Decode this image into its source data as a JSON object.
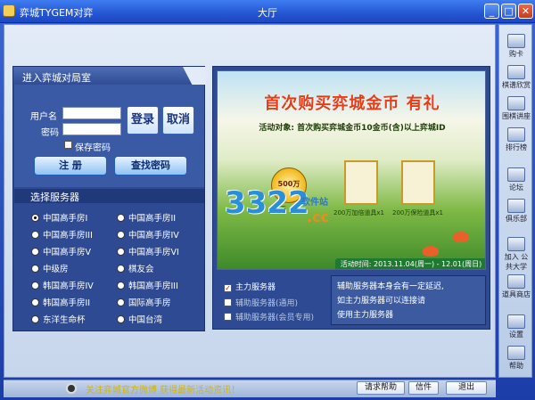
{
  "window": {
    "app_title": "弈城TYGEM对弈",
    "center_title": "大厅",
    "controls": [
      "minimize",
      "maximize",
      "close"
    ]
  },
  "sidebar": {
    "items": [
      {
        "label": "购卡",
        "icon": "card-icon"
      },
      {
        "label": "棋谱欣赏",
        "icon": "board-icon"
      },
      {
        "label": "围棋讲座",
        "icon": "lecture-icon"
      },
      {
        "label": "排行榜",
        "icon": "ranking-icon"
      },
      {
        "label": "论坛",
        "icon": "forum-icon"
      },
      {
        "label": "俱乐部",
        "icon": "club-icon"
      },
      {
        "label": "加入 公共大学",
        "icon": "join-icon"
      },
      {
        "label": "道具商店",
        "icon": "shop-icon"
      },
      {
        "label": "设置",
        "icon": "settings-icon"
      },
      {
        "label": "帮助",
        "icon": "help-icon"
      }
    ]
  },
  "login": {
    "header": "进入弈城对局室",
    "username_label": "用户名",
    "password_label": "密码",
    "username_value": "",
    "password_value": "",
    "remember_label": "保存密码",
    "login_button": "登录",
    "cancel_button": "取消",
    "register_button": "注 册",
    "find_password_button": "查找密码"
  },
  "servers": {
    "header": "选择服务器",
    "selected": 0,
    "items": [
      "中国高手房I",
      "中国高手房II",
      "中国高手房III",
      "中国高手房IV",
      "中国高手房V",
      "中国高手房VI",
      "中级房",
      "棋友会",
      "韩国高手房IV",
      "韩国高手房III",
      "韩国高手房II",
      "国际高手房",
      "东洋生命杯",
      "中国台湾"
    ]
  },
  "banner": {
    "title": "首次购买弈城金币 有礼",
    "subtitle": "活动对象: 首次购买弈城金币10金币(含)以上弈城ID",
    "coin_amount": "500万",
    "coin_label": "弈币",
    "item1_label": "200万加倍道具x1",
    "item2_label": "200万保险道具x1",
    "watermark_number": "3322",
    "watermark_cn": "软件站",
    "watermark_cc": ".cc",
    "date": "活动时间: 2013.11.04(周一) - 12.01(周日)"
  },
  "server_options": {
    "items": [
      {
        "label": "主力服务器",
        "checked": true
      },
      {
        "label": "辅助服务器(通用)",
        "checked": false
      },
      {
        "label": "辅助服务器(会员专用)",
        "checked": false
      }
    ],
    "note_lines": [
      "辅助服务器本身会有一定延迟,",
      "如主力服务器可以连接请",
      "使用主力服务器"
    ]
  },
  "bottom": {
    "ticker": "关注弈城官方微博 获得最新活动资讯！",
    "help_button": "请求帮助",
    "mail_button": "信件",
    "exit_button": "退出"
  }
}
